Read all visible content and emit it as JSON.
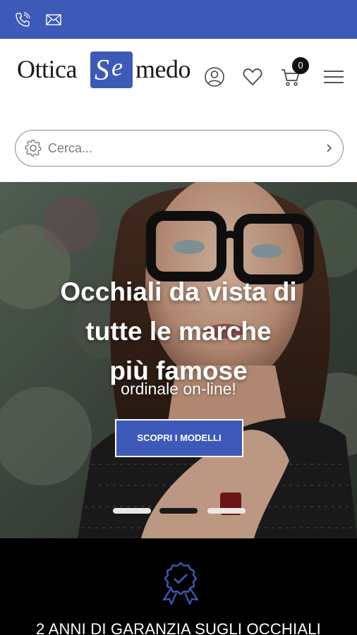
{
  "topbar": {
    "icons": [
      "phone-icon",
      "mail-icon"
    ],
    "color": "#3d5ab8"
  },
  "header": {
    "logo": {
      "word1": "Ottica",
      "mark1": "S",
      "mark2": "e",
      "word2": "medo"
    },
    "icons": [
      "user-icon",
      "heart-icon",
      "cart-icon",
      "menu-icon"
    ],
    "cart_count": "0"
  },
  "search": {
    "placeholder": "Cerca...",
    "icon": "gear-icon",
    "submit_icon": "chevron-right-icon"
  },
  "hero": {
    "title_line1": "Occhiali da vista di",
    "title_line2": "tutte le marche",
    "title_line3": "più famose",
    "subtitle": "ordinale on-line!",
    "cta_label": "SCOPRI I MODELLI",
    "slide_count": 3,
    "active_slide": 2
  },
  "feature": {
    "icon": "award-ribbon-icon",
    "text": "2 ANNI DI GARANZIA SUGLI OCCHIALI"
  },
  "colors": {
    "brand": "#3d5ab8",
    "dark": "#000000"
  }
}
